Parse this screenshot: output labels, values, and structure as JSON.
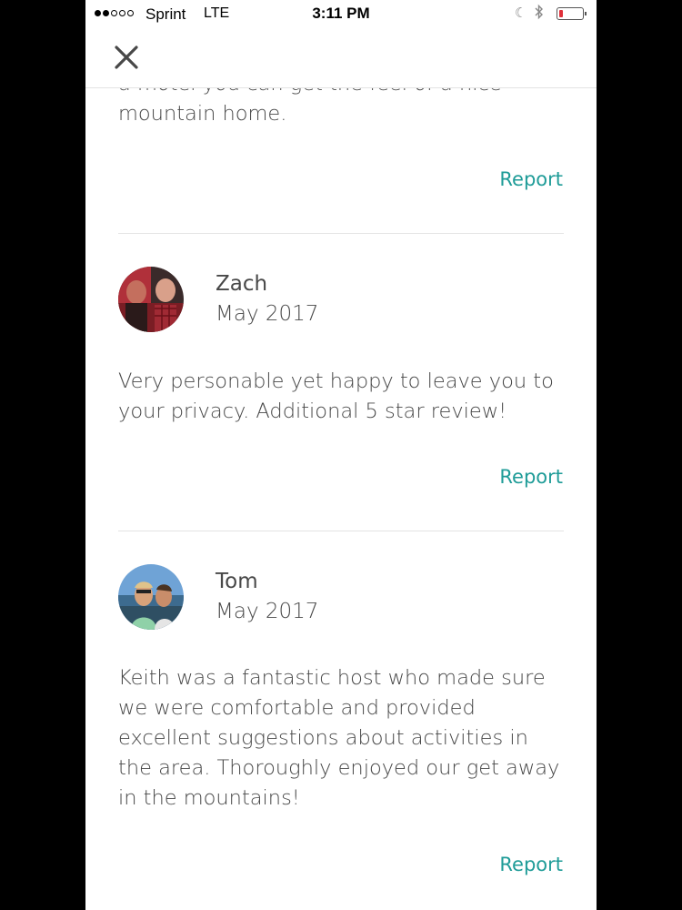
{
  "status_bar": {
    "carrier": "Sprint",
    "network": "LTE",
    "time": "3:11 PM",
    "icons": [
      "moon-icon",
      "bluetooth-icon",
      "battery-icon"
    ],
    "signal_bars_filled": 2
  },
  "header": {
    "close_icon": "close-icon"
  },
  "reviews": [
    {
      "text_partial": "a motel you can get the feel of a nice",
      "text_tail": "mountain home.",
      "report_label": "Report"
    },
    {
      "name": "Zach",
      "date": "May 2017",
      "text": "Very personable yet happy to leave you to your privacy. Additional 5 star review!",
      "report_label": "Report"
    },
    {
      "name": "Tom",
      "date": "May 2017",
      "text": "Keith was a fantastic host who made sure we were comfortable and provided excellent suggestions about activities in the area. Thoroughly enjoyed our get away in the mountains!",
      "report_label": "Report"
    }
  ],
  "colors": {
    "accent": "#1f9c98",
    "text": "#484848",
    "divider": "#e4e4e4"
  }
}
